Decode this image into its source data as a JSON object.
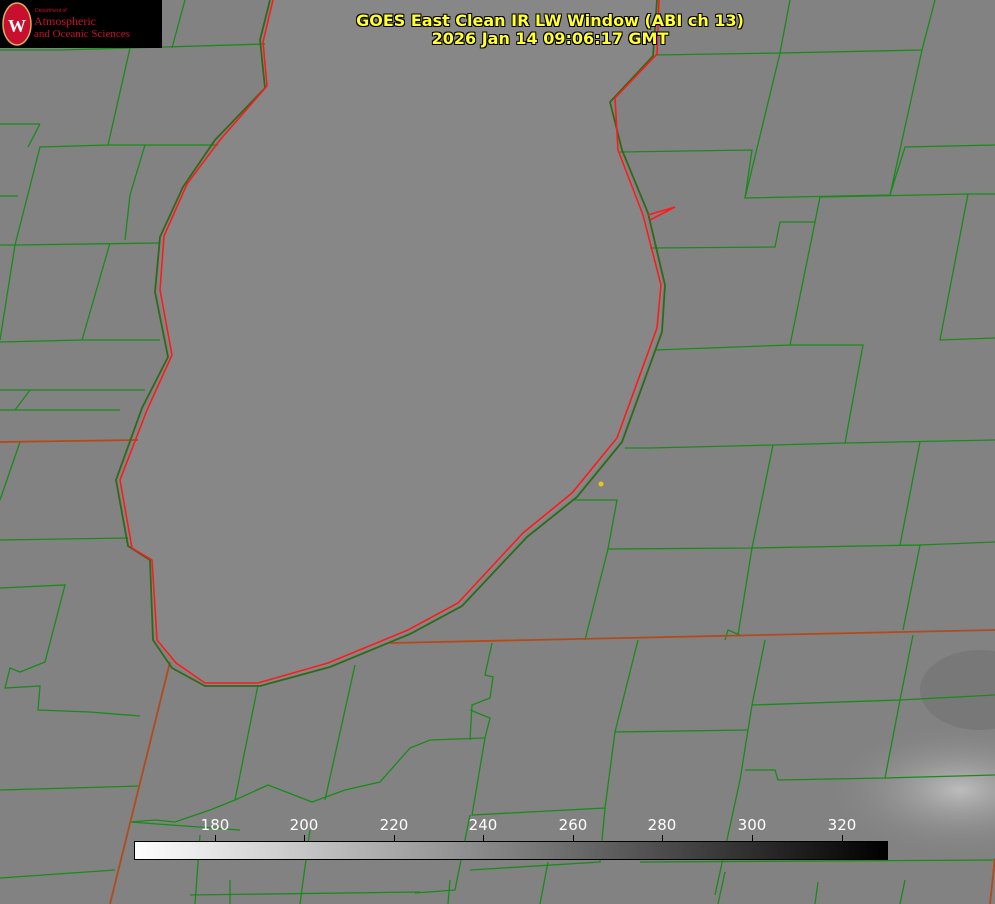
{
  "title": {
    "line1": "GOES East Clean IR LW Window (ABI ch 13)",
    "line2": "2026 Jan 14 09:06:17 GMT"
  },
  "logo": {
    "dept": "Department of",
    "line1": "Atmospheric",
    "line2": "and Oceanic Sciences",
    "seal_letter": "W"
  },
  "colorbar": {
    "ticks": [
      "180",
      "200",
      "220",
      "240",
      "260",
      "280",
      "300",
      "320"
    ],
    "gradient": [
      "#ffffff",
      "#000000"
    ]
  },
  "colors": {
    "background": "#808080",
    "county_lines": "#1a8a1a",
    "lake_outline": "#ff1a1a",
    "state_lines": "#b34a1a",
    "title_text": "#ffff33",
    "site_marker": "#e6c619"
  }
}
